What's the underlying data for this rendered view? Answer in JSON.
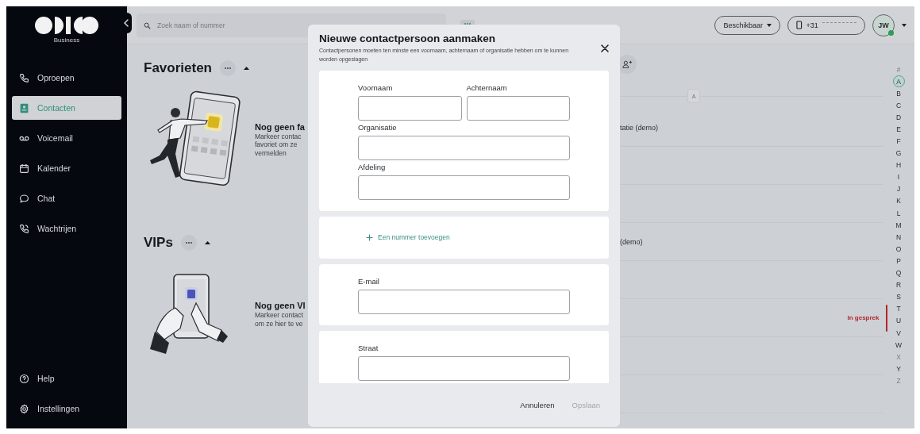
{
  "sidebar": {
    "brand": "Business",
    "nav": [
      {
        "label": "Oproepen",
        "selected": false
      },
      {
        "label": "Contacten",
        "selected": true
      },
      {
        "label": "Voicemail",
        "selected": false
      },
      {
        "label": "Kalender",
        "selected": false
      },
      {
        "label": "Chat",
        "selected": false
      },
      {
        "label": "Wachtrijen",
        "selected": false
      }
    ],
    "footer": [
      {
        "label": "Help"
      },
      {
        "label": "Instellingen"
      }
    ]
  },
  "topbar": {
    "search": {
      "placeholder": "Zoek naam of nummer"
    },
    "status": {
      "label": "Beschikbaar"
    },
    "phone": {
      "number": "+31"
    },
    "avatar": {
      "initials": "JW",
      "online": true
    }
  },
  "sections": [
    {
      "kind": "favorites",
      "title": "Favorieten",
      "expanded": true,
      "empty_title": "Nog geen fa",
      "empty_lines": [
        "Markeer contac",
        "favoriet om ze",
        "vermelden"
      ]
    },
    {
      "kind": "vips",
      "title": "VIPs",
      "expanded": true,
      "empty_title": "Nog geen VI",
      "empty_lines": [
        "Markeer contact",
        "om ze hier te ve"
      ]
    }
  ],
  "contacts": {
    "group_letter": "A",
    "rows": [
      {
        "name": "tatie (demo)"
      },
      {},
      {},
      {
        "name": "(demo)"
      },
      {},
      {
        "status": "In gesprek"
      },
      {},
      {}
    ]
  },
  "index": [
    {
      "label": "#",
      "selected": false,
      "disabled": true
    },
    {
      "label": "A",
      "selected": true,
      "disabled": false
    },
    {
      "label": "B",
      "selected": false,
      "disabled": false
    },
    {
      "label": "C",
      "selected": false,
      "disabled": false
    },
    {
      "label": "D",
      "selected": false,
      "disabled": false
    },
    {
      "label": "E",
      "selected": false,
      "disabled": false
    },
    {
      "label": "F",
      "selected": false,
      "disabled": false
    },
    {
      "label": "G",
      "selected": false,
      "disabled": false
    },
    {
      "label": "H",
      "selected": false,
      "disabled": false
    },
    {
      "label": "I",
      "selected": false,
      "disabled": false
    },
    {
      "label": "J",
      "selected": false,
      "disabled": false
    },
    {
      "label": "K",
      "selected": false,
      "disabled": false
    },
    {
      "label": "L",
      "selected": false,
      "disabled": false
    },
    {
      "label": "M",
      "selected": false,
      "disabled": false
    },
    {
      "label": "N",
      "selected": false,
      "disabled": false
    },
    {
      "label": "O",
      "selected": false,
      "disabled": false
    },
    {
      "label": "P",
      "selected": false,
      "disabled": false
    },
    {
      "label": "Q",
      "selected": false,
      "disabled": false
    },
    {
      "label": "R",
      "selected": false,
      "disabled": false
    },
    {
      "label": "S",
      "selected": false,
      "disabled": false
    },
    {
      "label": "T",
      "selected": false,
      "disabled": false
    },
    {
      "label": "U",
      "selected": false,
      "disabled": false
    },
    {
      "label": "V",
      "selected": false,
      "disabled": false
    },
    {
      "label": "W",
      "selected": false,
      "disabled": false
    },
    {
      "label": "X",
      "selected": false,
      "disabled": true
    },
    {
      "label": "Y",
      "selected": false,
      "disabled": false
    },
    {
      "label": "Z",
      "selected": false,
      "disabled": true
    }
  ],
  "modal": {
    "title": "Nieuwe contactpersoon aanmaken",
    "subtitle": "Contactpersonen moeten ten minste een voornaam, achternaam of organisatie hebben om te kunnen worden opgeslagen",
    "cards": [
      {
        "kind": "fields",
        "rows": [
          [
            {
              "label": "Voornaam"
            },
            {
              "label": "Achternaam"
            }
          ],
          [
            {
              "label": "Organisatie"
            }
          ],
          [
            {
              "label": "Afdeling"
            }
          ]
        ]
      },
      {
        "kind": "link",
        "label": "Een nummer toevoegen"
      },
      {
        "kind": "fields",
        "rows": [
          [
            {
              "label": "E-mail"
            }
          ]
        ]
      },
      {
        "kind": "fields",
        "rows": [
          [
            {
              "label": "Straat"
            }
          ]
        ]
      }
    ],
    "buttons": [
      {
        "label": "Annuleren",
        "disabled": false
      },
      {
        "label": "Opslaan",
        "disabled": true
      }
    ]
  }
}
